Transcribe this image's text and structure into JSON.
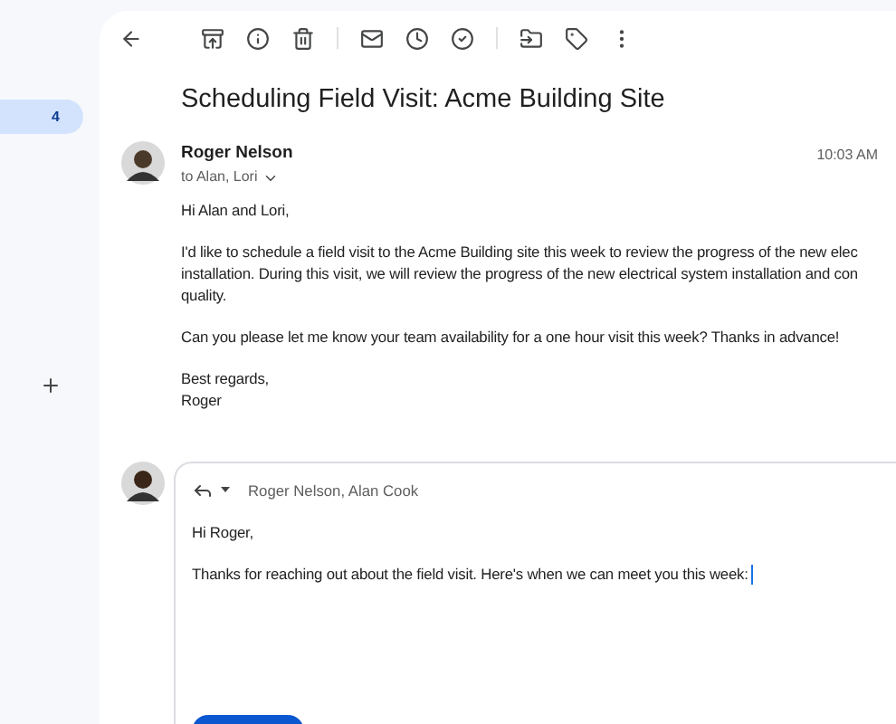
{
  "sidebar": {
    "count": "4"
  },
  "subject": "Scheduling Field Visit: Acme Building Site",
  "message": {
    "sender": "Roger Nelson",
    "recipients": "to Alan, Lori",
    "time": "10:03 AM",
    "paragraphs": [
      [
        "Hi Alan and Lori,"
      ],
      [
        "I'd like to schedule a field visit to the Acme Building site this week to review the progress of the new elec",
        "installation. During this visit, we will review the progress of the new electrical system installation and con",
        "quality."
      ],
      [
        "Can you please let me know your team availability for a one hour visit this week? Thanks in advance!"
      ],
      [
        "Best regards,",
        "Roger"
      ]
    ]
  },
  "reply": {
    "recipients": "Roger Nelson, Alan Cook",
    "lines": [
      "Hi Roger,",
      "Thanks for reaching out about the field visit. Here's when we can meet you this week:"
    ]
  }
}
